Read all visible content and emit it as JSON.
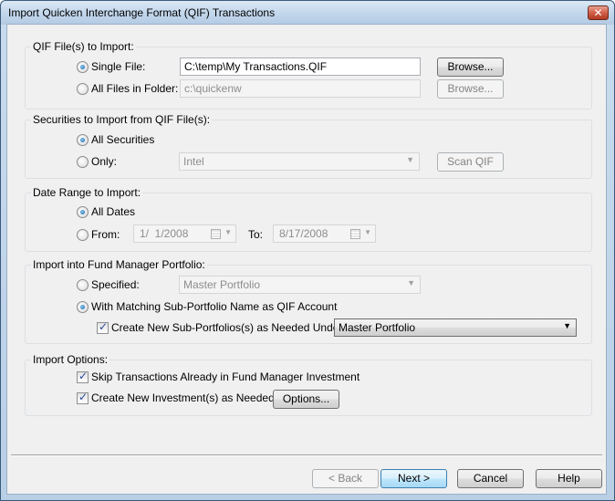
{
  "window": {
    "title": "Import Quicken Interchange Format (QIF) Transactions",
    "close_glyph": "✕"
  },
  "qif_files": {
    "label": "QIF File(s) to Import:",
    "single_file": {
      "label": "Single File:",
      "selected": true,
      "value": "C:\\temp\\My Transactions.QIF",
      "browse_label": "Browse..."
    },
    "all_files": {
      "label": "All Files in Folder:",
      "selected": false,
      "value": "c:\\quickenw",
      "browse_label": "Browse..."
    }
  },
  "securities": {
    "label": "Securities to Import from QIF File(s):",
    "all": {
      "label": "All Securities",
      "selected": true
    },
    "only": {
      "label": "Only:",
      "selected": false,
      "value": "Intel"
    },
    "scan_label": "Scan QIF"
  },
  "date_range": {
    "label": "Date Range to Import:",
    "all": {
      "label": "All Dates",
      "selected": true
    },
    "from": {
      "label": "From:",
      "selected": false,
      "value": "1/  1/2008"
    },
    "to": {
      "label": "To:",
      "value": "8/17/2008"
    }
  },
  "portfolio": {
    "label": "Import into Fund Manager Portfolio:",
    "specified": {
      "label": "Specified:",
      "selected": false,
      "value": "Master Portfolio"
    },
    "matching": {
      "label": "With Matching Sub-Portfolio Name as QIF Account",
      "selected": true
    },
    "create_sub": {
      "label": "Create New Sub-Portfolios(s) as Needed Under:",
      "checked": true,
      "value": "Master Portfolio"
    }
  },
  "import_options": {
    "label": "Import Options:",
    "skip": {
      "label": "Skip Transactions Already in Fund Manager Investment",
      "checked": true
    },
    "create_inv": {
      "label": "Create New Investment(s) as Needed",
      "checked": true
    },
    "options_label": "Options..."
  },
  "footer": {
    "back_label": "< Back",
    "next_label": "Next >",
    "cancel_label": "Cancel",
    "help_label": "Help"
  }
}
